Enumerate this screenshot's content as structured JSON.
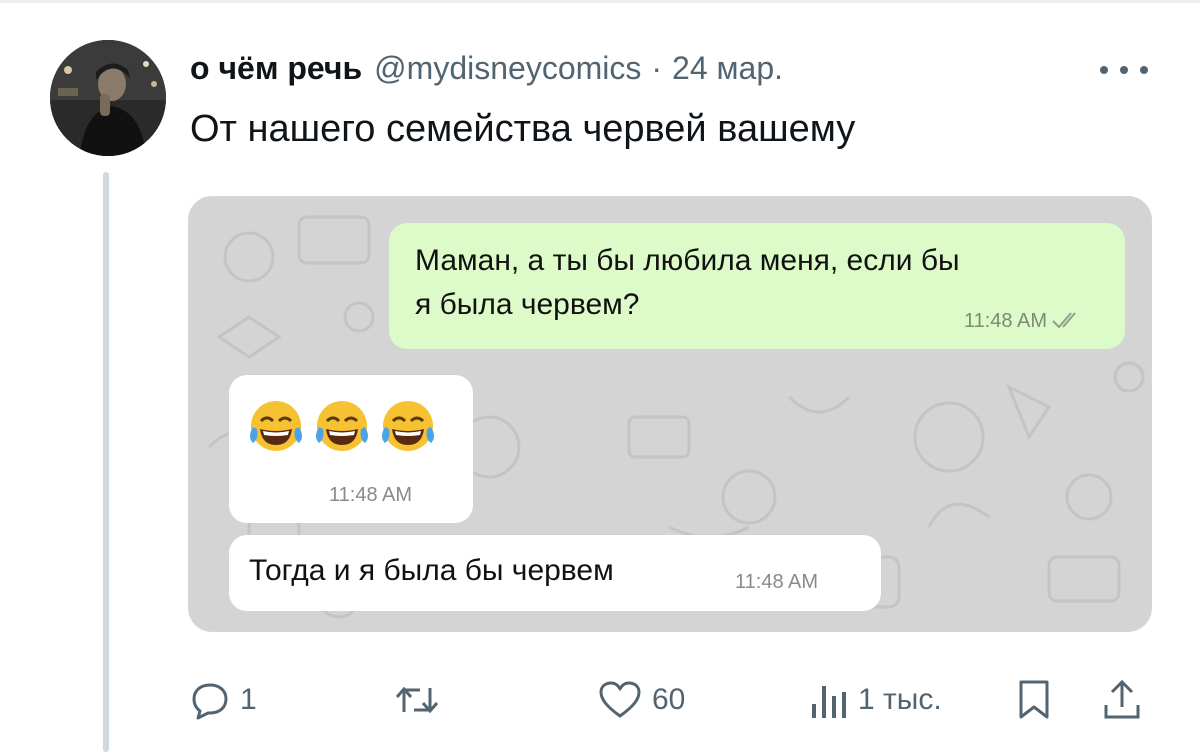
{
  "post": {
    "author_name": "о чём речь",
    "handle": "@mydisneycomics",
    "separator": "·",
    "date": "24 мар.",
    "text": "От нашего семейства червей вашему"
  },
  "chat": {
    "outgoing": {
      "line1": "Маман, а ты бы любила меня, если бы",
      "line2": "я была червем?",
      "time": "11:48 AM",
      "status": "read"
    },
    "incoming_emoji": {
      "emojis": [
        "😂",
        "😂",
        "😂"
      ],
      "time": "11:48 AM"
    },
    "incoming_text": {
      "text": "Тогда и я была бы червем",
      "time": "11:48 AM"
    }
  },
  "actions": {
    "replies": "1",
    "reposts": "",
    "likes": "60",
    "views": "1 тыс."
  },
  "colors": {
    "outgoing_bubble": "#ddfbc8",
    "chat_background": "#d4d4d4",
    "secondary_text": "#536471"
  }
}
